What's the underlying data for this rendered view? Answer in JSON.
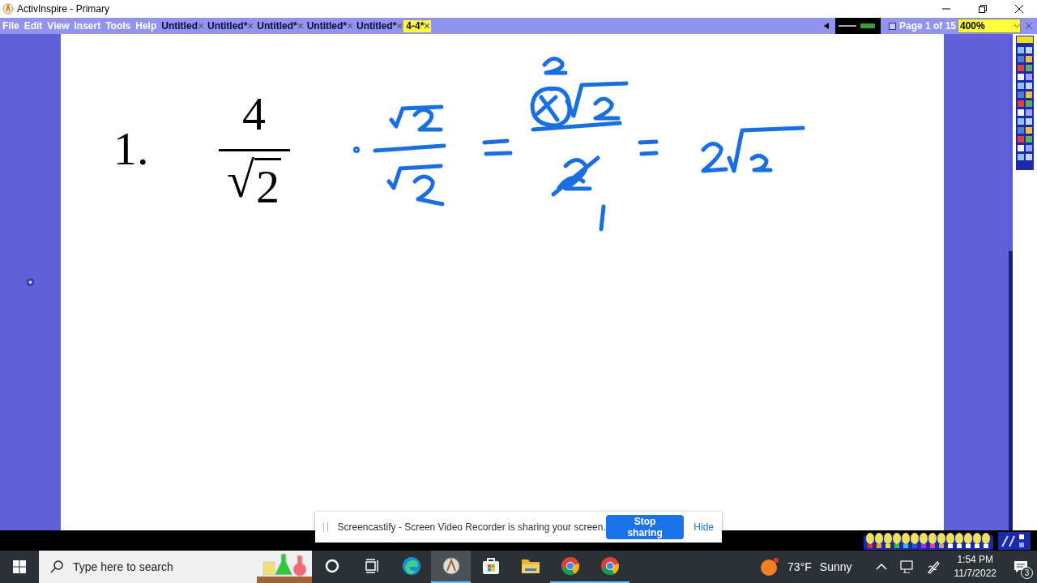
{
  "window": {
    "title": "ActivInspire - Primary"
  },
  "menu": [
    "File",
    "Edit",
    "View",
    "Insert",
    "Tools",
    "Help"
  ],
  "documents": [
    {
      "label": "Untitled",
      "selected": false
    },
    {
      "label": "Untitled*",
      "selected": false
    },
    {
      "label": "Untitled*",
      "selected": false
    },
    {
      "label": "Untitled*",
      "selected": false
    },
    {
      "label": "Untitled*",
      "selected": false
    },
    {
      "label": "4-4*",
      "selected": true
    }
  ],
  "page_indicator": "Page 1 of 15",
  "zoom": "400%",
  "page": {
    "number": "1.",
    "numerator": "4",
    "radical": "√",
    "radicand": "2"
  },
  "sharing": {
    "message": "Screencastify - Screen Video Recorder is sharing your screen.",
    "stop_button": "Stop sharing",
    "hide_link": "Hide"
  },
  "taskbar": {
    "search_placeholder": "Type here to search",
    "apps": [
      {
        "kind": "cortana",
        "running": false,
        "selected": false
      },
      {
        "kind": "taskview",
        "running": false,
        "selected": false
      },
      {
        "kind": "edge",
        "running": false,
        "selected": false
      },
      {
        "kind": "activinspire",
        "running": true,
        "selected": true
      },
      {
        "kind": "store",
        "running": false,
        "selected": false
      },
      {
        "kind": "explorer",
        "running": false,
        "selected": false
      },
      {
        "kind": "chrome",
        "running": true,
        "selected": false
      },
      {
        "kind": "chrome",
        "running": true,
        "selected": false
      }
    ],
    "weather": {
      "temperature": "73°F",
      "condition": "Sunny"
    },
    "time": "1:54 PM",
    "date": "11/7/2022",
    "notification_count": "3"
  }
}
